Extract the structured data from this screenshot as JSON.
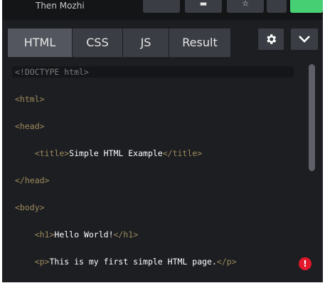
{
  "header": {
    "owner_name": "Then Mozhi"
  },
  "tabs": [
    {
      "label": "HTML",
      "active": true
    },
    {
      "label": "CSS",
      "active": false
    },
    {
      "label": "JS",
      "active": false
    },
    {
      "label": "Result",
      "active": false
    }
  ],
  "toolbar": {
    "settings_icon": "gear-icon",
    "collapse_icon": "chevron-down-icon"
  },
  "editor": {
    "language": "html",
    "lines": [
      {
        "text": "<!DOCTYPE html>"
      },
      {
        "text": "<html>"
      },
      {
        "text": "<head>"
      },
      {
        "pre": "    ",
        "open": "<title>",
        "content": "Simple HTML Example",
        "close": "</title>"
      },
      {
        "text": "</head>"
      },
      {
        "text": "<body>"
      },
      {
        "pre": "    ",
        "open": "<h1>",
        "content": "Hello World!",
        "close": "</h1>"
      },
      {
        "pre": "    ",
        "open": "<p>",
        "content": "This is my first simple HTML page.",
        "close": "</p>"
      }
    ]
  },
  "status": {
    "error_icon_label": "!"
  },
  "colors": {
    "background": "#1d1e22",
    "tab": "#3b3d44",
    "tab_active": "#53565f",
    "tag": "#9b8a5b",
    "accent_green": "#47cf73",
    "error": "#e2192c"
  }
}
